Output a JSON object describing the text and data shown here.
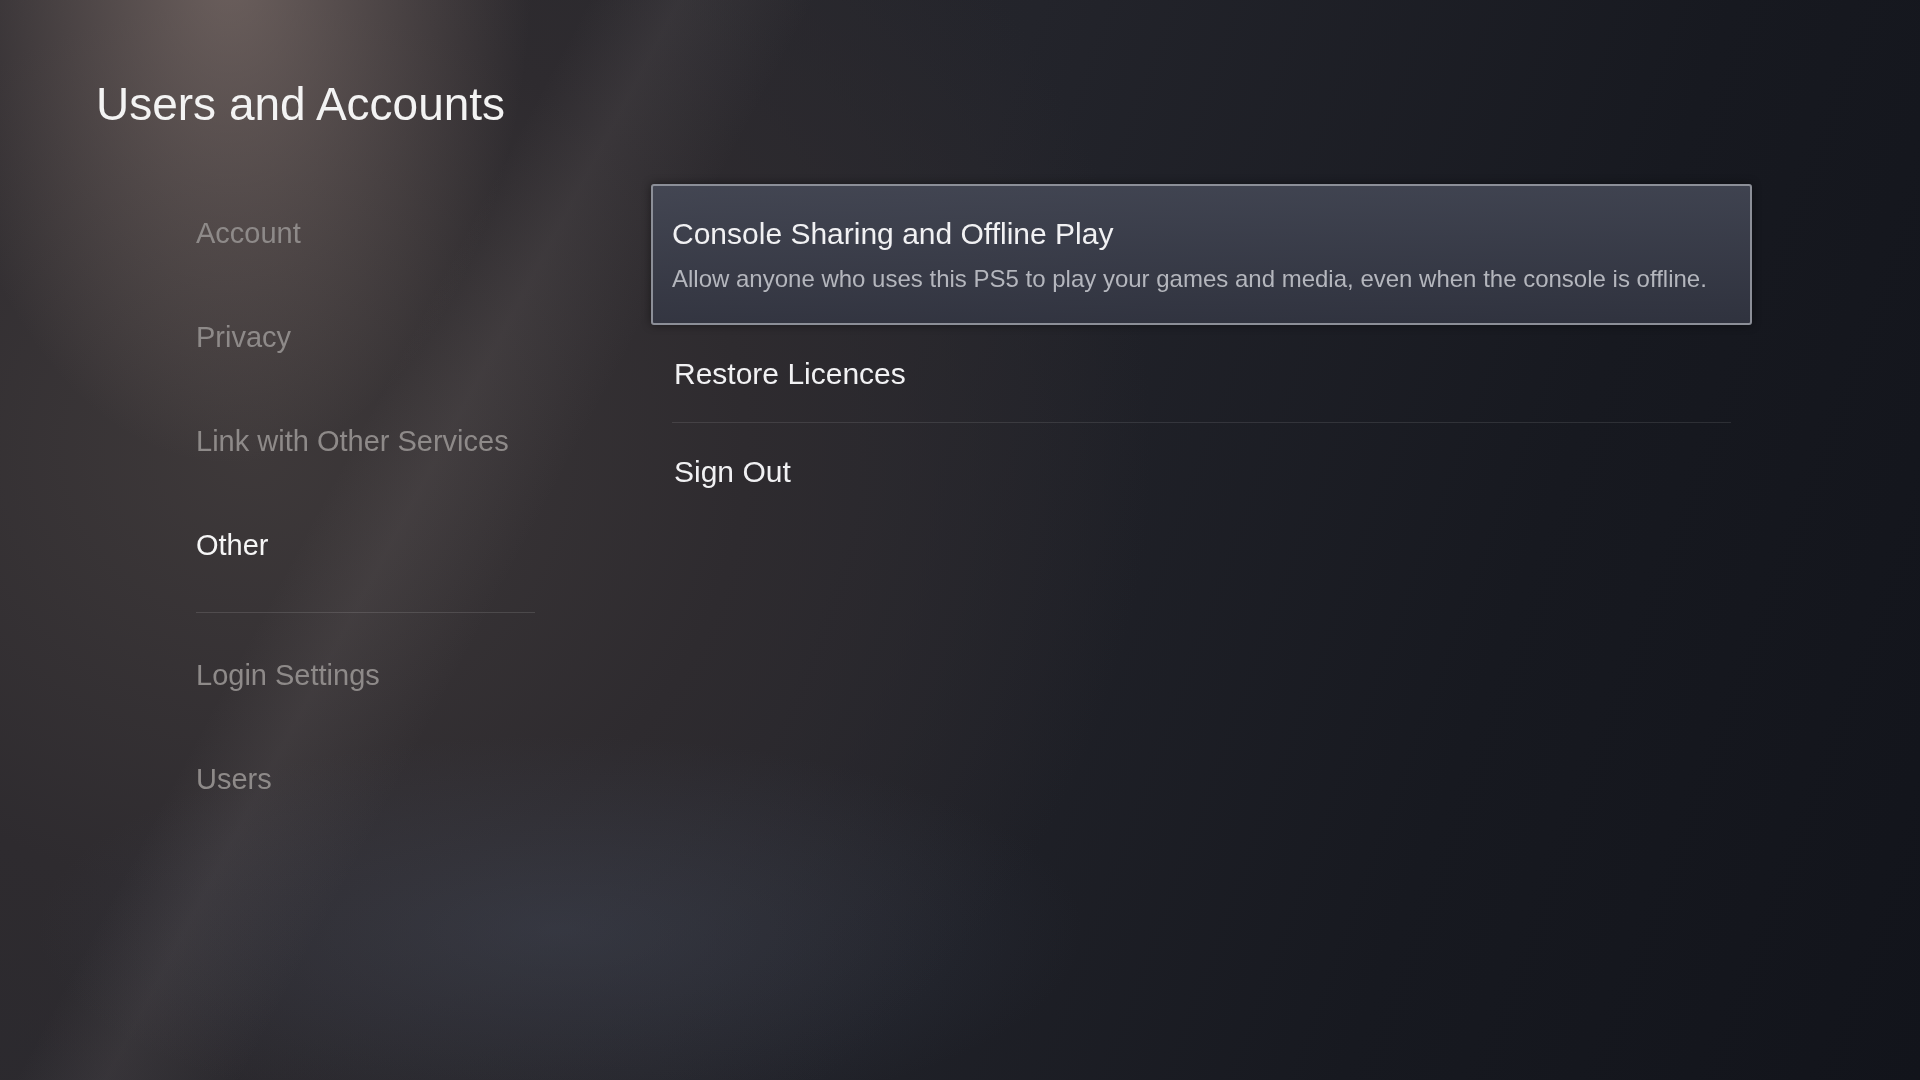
{
  "page": {
    "title": "Users and Accounts"
  },
  "sidebar": {
    "groups": [
      {
        "items": [
          {
            "label": "Account",
            "selected": false
          },
          {
            "label": "Privacy",
            "selected": false
          },
          {
            "label": "Link with Other Services",
            "selected": false
          },
          {
            "label": "Other",
            "selected": true
          }
        ]
      },
      {
        "items": [
          {
            "label": "Login Settings",
            "selected": false
          },
          {
            "label": "Users",
            "selected": false
          }
        ]
      }
    ]
  },
  "options": [
    {
      "label": "Console Sharing and Offline Play",
      "description": "Allow anyone who uses this PS5 to play your games and media, even when the console is offline.",
      "selected": true
    },
    {
      "label": "Restore Licences",
      "selected": false
    },
    {
      "label": "Sign Out",
      "selected": false
    }
  ]
}
